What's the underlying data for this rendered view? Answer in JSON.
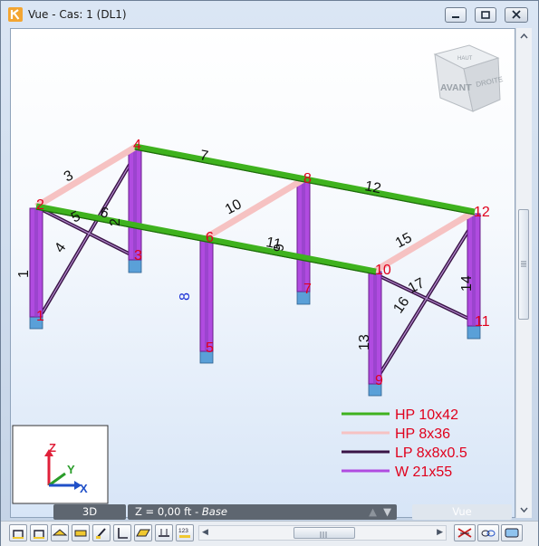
{
  "window": {
    "title": "Vue - Cas: 1 (DL1)",
    "controls": [
      "minimize",
      "restore",
      "close"
    ]
  },
  "view_cube": {
    "face_front": "AVANT",
    "face_right": "DROITE",
    "face_top": "HAUT"
  },
  "nodes": [
    "1",
    "2",
    "3",
    "4",
    "5",
    "6",
    "7",
    "8",
    "9",
    "10",
    "11",
    "12"
  ],
  "members": [
    "1",
    "2",
    "3",
    "4",
    "5",
    "6",
    "7",
    "8",
    "9",
    "10",
    "11",
    "12",
    "13",
    "14",
    "15",
    "16",
    "17"
  ],
  "legend": [
    {
      "label": "HP 10x42",
      "color": "#3fb21e"
    },
    {
      "label": "HP 8x36",
      "color": "#f6c2c2"
    },
    {
      "label": "LP 8x8x0.5",
      "color": "#3a1446"
    },
    {
      "label": "W 21x55",
      "color": "#b04be0"
    }
  ],
  "axes": {
    "z": "Z",
    "y": "Y",
    "x": "X"
  },
  "status": {
    "view_mode": "3D",
    "level_text": "Z = 0,00 ft",
    "level_sep": " - ",
    "level_name": "Base",
    "view_btn": "Vue"
  },
  "colors": {
    "node_label": "#e0001c",
    "member_label": "#111111",
    "member_label_highlight": "#1a2fd6",
    "column": "#b04be0",
    "brace": "#3a1446",
    "beam_green": "#3fb21e",
    "beam_pink": "#f6c2c2"
  }
}
